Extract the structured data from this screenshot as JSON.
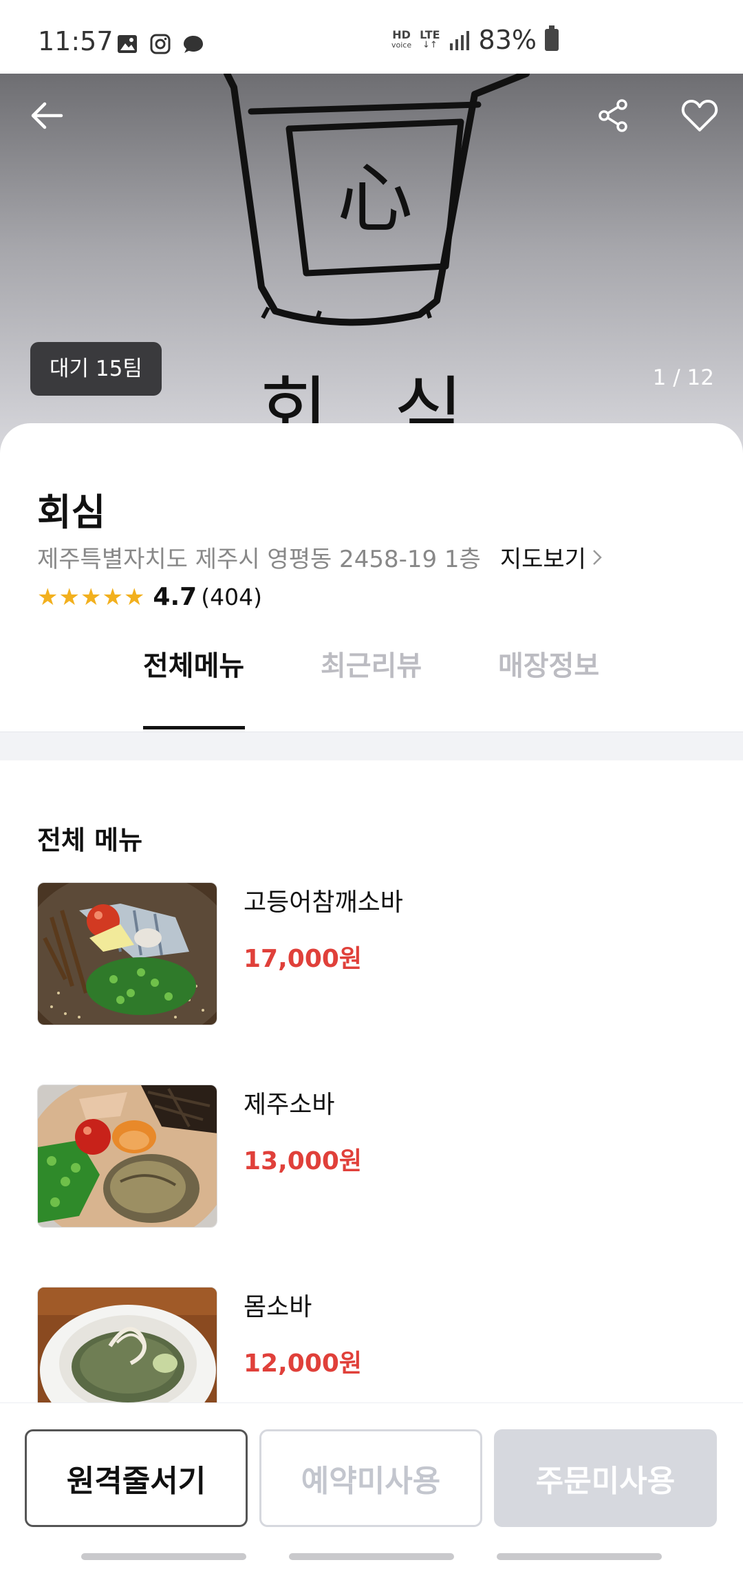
{
  "status_bar": {
    "time": "11:57",
    "network_top": "HD",
    "network_sub": "voice",
    "lte": "LTE",
    "battery": "83%",
    "icons": [
      "gallery-icon",
      "instagram-icon",
      "chat-icon",
      "signal-icon",
      "battery-icon"
    ]
  },
  "hero": {
    "wait_badge": "대기 15팀",
    "image_counter": "1 / 12",
    "logo_char": "心",
    "logo_text": "회 심"
  },
  "store": {
    "name": "회심",
    "address": "제주특별자치도 제주시 영평동 2458-19 1층",
    "map_link": "지도보기",
    "rating": "4.7",
    "review_count": "(404)",
    "stars": 5
  },
  "tabs": [
    {
      "label": "전체메뉴",
      "active": true
    },
    {
      "label": "최근리뷰",
      "active": false
    },
    {
      "label": "매장정보",
      "active": false
    }
  ],
  "menu": {
    "section_title": "전체 메뉴",
    "items": [
      {
        "name": "고등어참깨소바",
        "price": "17,000원"
      },
      {
        "name": "제주소바",
        "price": "13,000원"
      },
      {
        "name": "몸소바",
        "price": "12,000원"
      }
    ]
  },
  "bottom_bar": {
    "remote_queue": "원격줄서기",
    "reservation": "예약미사용",
    "order": "주문미사용"
  },
  "colors": {
    "accent_price": "#e0403a",
    "star": "#f2b01e",
    "disabled": "#d6d8de"
  }
}
